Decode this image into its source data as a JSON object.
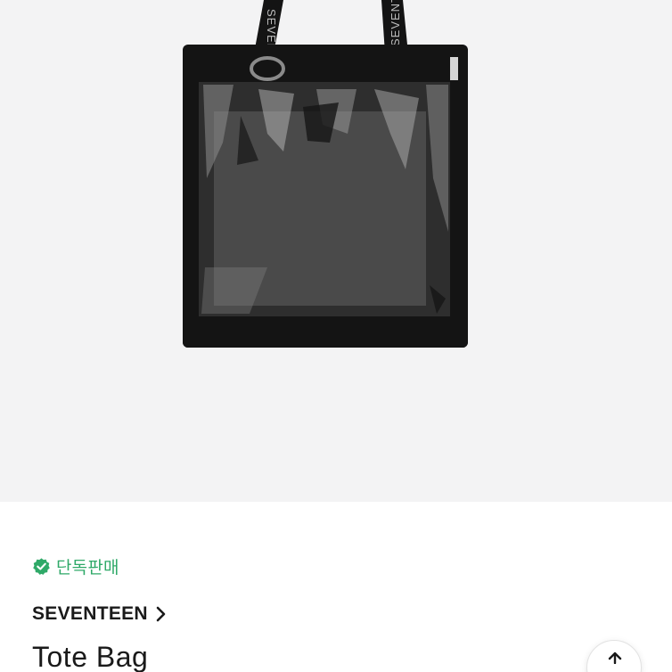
{
  "product_image": {
    "alt": "SEVENTEEN clear tote bag",
    "strap_print": "SEVENTEEN",
    "colors": {
      "background": "#f3f3f4",
      "bag_frame": "#141414",
      "panel": "#3d3d3d"
    }
  },
  "product": {
    "badge_icon": "verified-check-icon",
    "badge_label": "단독판매",
    "badge_color": "#2fa968",
    "brand": "SEVENTEEN",
    "brand_icon": "chevron-right-icon",
    "name": "Tote Bag"
  },
  "floating": {
    "scroll_top_icon": "arrow-up-icon"
  }
}
